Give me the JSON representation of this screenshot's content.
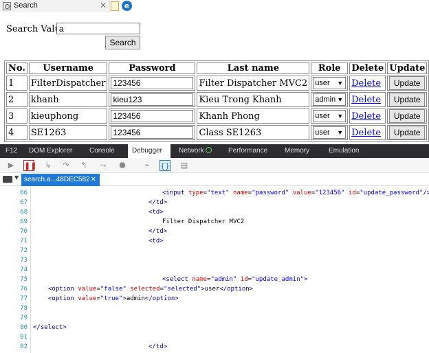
{
  "browser": {
    "tab_title": "Search",
    "close_glyph": "✕"
  },
  "search": {
    "label": "Search Value:",
    "value": "a",
    "button": "Search"
  },
  "table": {
    "headers": [
      "No.",
      "Username",
      "Password",
      "Last name",
      "Role",
      "Delete",
      "Update"
    ],
    "rows": [
      {
        "no": "1",
        "username": "FilterDispatcher",
        "password": "123456",
        "last_name": "Filter Dispatcher MVC2",
        "role": "user",
        "delete": "Delete",
        "update": "Update"
      },
      {
        "no": "2",
        "username": "khanh",
        "password": "kieu123",
        "last_name": "Kieu Trong Khanh",
        "role": "admin",
        "delete": "Delete",
        "update": "Update"
      },
      {
        "no": "3",
        "username": "kieuphong",
        "password": "123456",
        "last_name": "Khanh Phong",
        "role": "user",
        "delete": "Delete",
        "update": "Update"
      },
      {
        "no": "4",
        "username": "SE1263",
        "password": "123456",
        "last_name": "Class SE1263",
        "role": "user",
        "delete": "Delete",
        "update": "Update"
      }
    ]
  },
  "devtools": {
    "tabs": [
      "F12",
      "DOM Explorer",
      "Console",
      "Debugger",
      "Network",
      "Performance",
      "Memory",
      "Emulation"
    ],
    "active_tab": "Debugger",
    "file_tab": "search.a...48DEC582",
    "code_lines": [
      {
        "n": "66",
        "text": "<input type=\"text\" name=\"password\" value=\"123456\" id=\"update_password\"/>"
      },
      {
        "n": "67",
        "text": "</td>"
      },
      {
        "n": "68",
        "text": "<td>"
      },
      {
        "n": "69",
        "text": "Filter Dispatcher MVC2"
      },
      {
        "n": "70",
        "text": "</td>"
      },
      {
        "n": "71",
        "text": "<td>"
      },
      {
        "n": "72",
        "text": ""
      },
      {
        "n": "73",
        "text": ""
      },
      {
        "n": "74",
        "text": ""
      },
      {
        "n": "75",
        "text": "<select name=\"admin\" id=\"update_admin\">"
      },
      {
        "n": "76",
        "text": "<option value=\"false\" selected=\"selected\">user</option>"
      },
      {
        "n": "77",
        "text": "<option value=\"true\">admin</option>"
      },
      {
        "n": "78",
        "text": ""
      },
      {
        "n": "79",
        "text": ""
      },
      {
        "n": "80",
        "text": "</select>"
      },
      {
        "n": "81",
        "text": ""
      },
      {
        "n": "82",
        "text": "</td>"
      }
    ]
  },
  "colors": {
    "devtools_tabbar": "#2d2d30",
    "accent": "#1e7ad6",
    "line_numbers": "#2b91af",
    "link": "#0000ee"
  }
}
